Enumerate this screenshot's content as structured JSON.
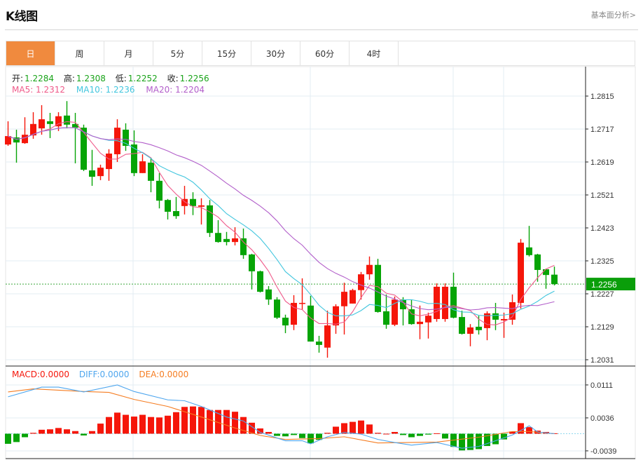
{
  "header": {
    "title": "K线图",
    "link": "基本面分析>"
  },
  "tabs": [
    {
      "label": "日",
      "active": true
    },
    {
      "label": "周"
    },
    {
      "label": "月"
    },
    {
      "label": "5分"
    },
    {
      "label": "15分"
    },
    {
      "label": "30分"
    },
    {
      "label": "60分"
    },
    {
      "label": "4时"
    }
  ],
  "ohlc_info": {
    "open_label": "开:",
    "open": "1.2284",
    "high_label": "高:",
    "high": "1.2308",
    "low_label": "低:",
    "low": "1.2252",
    "close_label": "收:",
    "close": "1.2256"
  },
  "ma_info": {
    "ma5": "MA5: 1.2312",
    "ma10": "MA10: 1.2236",
    "ma20": "MA20: 1.2204"
  },
  "macd_info": {
    "macd": "MACD:0.0000",
    "diff": "DIFF:0.0000",
    "dea": "DEA:0.0000"
  },
  "current_price": "1.2256",
  "colors": {
    "up": "#f5160a",
    "down": "#06a406",
    "ma5": "#ef5a8a",
    "ma10": "#42c6de",
    "ma20": "#b25fca",
    "diff": "#4ea6ee",
    "dea": "#f57d22",
    "accent": "#f08a3e"
  },
  "chart_data": [
    {
      "type": "candlestick",
      "y_ticks": [
        "1.2815",
        "1.2717",
        "1.2619",
        "1.2521",
        "1.2423",
        "1.2325",
        "1.2227",
        "1.2129",
        "1.2031"
      ],
      "ylim": [
        1.2031,
        1.2815
      ],
      "grid": true,
      "candles": [
        [
          1.2671,
          1.274,
          1.2667,
          1.2696
        ],
        [
          1.2692,
          1.2715,
          1.2617,
          1.2677
        ],
        [
          1.2675,
          1.2752,
          1.2673,
          1.27
        ],
        [
          1.2698,
          1.2767,
          1.2688,
          1.2732
        ],
        [
          1.2719,
          1.2788,
          1.27,
          1.2746
        ],
        [
          1.274,
          1.2765,
          1.269,
          1.2732
        ],
        [
          1.2725,
          1.2767,
          1.2711,
          1.2755
        ],
        [
          1.2757,
          1.28,
          1.2719,
          1.273
        ],
        [
          1.2732,
          1.2765,
          1.2615,
          1.2721
        ],
        [
          1.2721,
          1.273,
          1.2592,
          1.2596
        ],
        [
          1.2594,
          1.2655,
          1.2548,
          1.2575
        ],
        [
          1.2577,
          1.2611,
          1.2565,
          1.2602
        ],
        [
          1.2598,
          1.2657,
          1.2563,
          1.2644
        ],
        [
          1.2642,
          1.2746,
          1.2619,
          1.2721
        ],
        [
          1.2715,
          1.2734,
          1.2652,
          1.2667
        ],
        [
          1.2671,
          1.2713,
          1.2577,
          1.2586
        ],
        [
          1.2586,
          1.2642,
          1.2586,
          1.2621
        ],
        [
          1.2617,
          1.2632,
          1.2529,
          1.2563
        ],
        [
          1.2563,
          1.2586,
          1.2481,
          1.2504
        ],
        [
          1.2506,
          1.2509,
          1.2448,
          1.2471
        ],
        [
          1.2473,
          1.2515,
          1.245,
          1.2458
        ],
        [
          1.2488,
          1.2548,
          1.2463,
          1.2509
        ],
        [
          1.2509,
          1.2529,
          1.2461,
          1.2488
        ],
        [
          1.2486,
          1.2511,
          1.2433,
          1.249
        ],
        [
          1.249,
          1.2506,
          1.2396,
          1.2408
        ],
        [
          1.2408,
          1.2446,
          1.2379,
          1.2381
        ],
        [
          1.239,
          1.2411,
          1.2371,
          1.2381
        ],
        [
          1.2381,
          1.2425,
          1.2371,
          1.2392
        ],
        [
          1.2392,
          1.2421,
          1.2331,
          1.2342
        ],
        [
          1.2344,
          1.2346,
          1.224,
          1.2294
        ],
        [
          1.2294,
          1.2296,
          1.2231,
          1.2233
        ],
        [
          1.224,
          1.225,
          1.2194,
          1.221
        ],
        [
          1.221,
          1.2217,
          1.2152,
          1.2156
        ],
        [
          1.2156,
          1.2165,
          1.211,
          1.2133
        ],
        [
          1.2135,
          1.2223,
          1.2119,
          1.22
        ],
        [
          1.2198,
          1.2273,
          1.2179,
          1.22
        ],
        [
          1.2192,
          1.2221,
          1.2085,
          1.2085
        ],
        [
          1.2085,
          1.2102,
          1.2052,
          1.2075
        ],
        [
          1.2067,
          1.2177,
          1.2037,
          1.2133
        ],
        [
          1.2133,
          1.2196,
          1.2108,
          1.219
        ],
        [
          1.219,
          1.226,
          1.2106,
          1.2233
        ],
        [
          1.2198,
          1.2242,
          1.2198,
          1.2238
        ],
        [
          1.2238,
          1.2292,
          1.221,
          1.2285
        ],
        [
          1.2285,
          1.2338,
          1.2269,
          1.2313
        ],
        [
          1.2313,
          1.2331,
          1.2171,
          1.2173
        ],
        [
          1.2175,
          1.2225,
          1.2123,
          1.2135
        ],
        [
          1.2135,
          1.2219,
          1.2131,
          1.221
        ],
        [
          1.221,
          1.2217,
          1.2133,
          1.2181
        ],
        [
          1.2181,
          1.221,
          1.2135,
          1.2137
        ],
        [
          1.2137,
          1.2192,
          1.2092,
          1.2144
        ],
        [
          1.2142,
          1.2171,
          1.2094,
          1.2162
        ],
        [
          1.2152,
          1.2258,
          1.2144,
          1.2248
        ],
        [
          1.2152,
          1.2258,
          1.2144,
          1.2248
        ],
        [
          1.2248,
          1.229,
          1.2154,
          1.2156
        ],
        [
          1.2158,
          1.2177,
          1.2106,
          1.2108
        ],
        [
          1.2108,
          1.2137,
          1.2071,
          1.2127
        ],
        [
          1.2129,
          1.2162,
          1.2106,
          1.2119
        ],
        [
          1.2125,
          1.2175,
          1.2089,
          1.2169
        ],
        [
          1.2169,
          1.22,
          1.2119,
          1.215
        ],
        [
          1.2148,
          1.2171,
          1.2096,
          1.2152
        ],
        [
          1.215,
          1.2225,
          1.2135,
          1.2202
        ],
        [
          1.22,
          1.239,
          1.2183,
          1.2379
        ],
        [
          1.2365,
          1.2429,
          1.2338,
          1.2342
        ],
        [
          1.2344,
          1.2346,
          1.2263,
          1.2298
        ],
        [
          1.23,
          1.2302,
          1.2242,
          1.2283
        ],
        [
          1.2284,
          1.2308,
          1.2252,
          1.2256
        ]
      ],
      "moving_averages": [
        5,
        10,
        20
      ]
    },
    {
      "type": "bar+line",
      "y_ticks": [
        "0.0111",
        "0.0036",
        "-0.0039"
      ],
      "ylim": [
        -0.0039,
        0.0111
      ],
      "macd_hist": [
        -0.0023,
        -0.0019,
        -0.0008,
        0.0002,
        0.0009,
        0.001,
        0.0013,
        0.001,
        0.0006,
        -0.0004,
        0.0006,
        0.0023,
        0.0038,
        0.0048,
        0.0043,
        0.0039,
        0.0043,
        0.0038,
        0.0037,
        0.0041,
        0.0049,
        0.0061,
        0.0062,
        0.0061,
        0.0054,
        0.0054,
        0.0054,
        0.005,
        0.0038,
        0.0025,
        0.0012,
        0.0004,
        -0.0005,
        -0.0006,
        -0.0003,
        -0.001,
        -0.0022,
        -0.0014,
        0.0002,
        0.0016,
        0.0024,
        0.0027,
        0.003,
        0.0021,
        0.0002,
        0.0,
        0.0004,
        -0.0003,
        -0.0008,
        -0.0005,
        -0.0002,
        0.0001,
        -0.0011,
        -0.003,
        -0.0038,
        -0.0037,
        -0.0035,
        -0.0028,
        -0.0024,
        -0.0013,
        0.0005,
        0.0024,
        0.0015,
        0.0007,
        0.0004,
        0.0001
      ],
      "diff_points": [
        [
          0,
          0.0084
        ],
        [
          4,
          0.0106
        ],
        [
          6,
          0.0106
        ],
        [
          9,
          0.0095
        ],
        [
          13,
          0.0111
        ],
        [
          15,
          0.0096
        ],
        [
          19,
          0.0077
        ],
        [
          21,
          0.0075
        ],
        [
          23,
          0.0062
        ],
        [
          26,
          0.0038
        ],
        [
          28,
          0.0029
        ],
        [
          30,
          0.0003
        ],
        [
          33,
          -0.0016
        ],
        [
          35,
          -0.0016
        ],
        [
          36,
          -0.0023
        ],
        [
          38,
          -0.0007
        ],
        [
          40,
          0.0003
        ],
        [
          42,
          -0.0001
        ],
        [
          44,
          -0.0013
        ],
        [
          46,
          -0.002
        ],
        [
          48,
          -0.0026
        ],
        [
          51,
          -0.002
        ],
        [
          54,
          -0.0033
        ],
        [
          56,
          -0.0029
        ],
        [
          60,
          -0.0003
        ],
        [
          62,
          0.0018
        ],
        [
          63,
          0.0004
        ],
        [
          65,
          0.0
        ]
      ],
      "dea_points": [
        [
          0,
          0.0095
        ],
        [
          3,
          0.0102
        ],
        [
          9,
          0.0096
        ],
        [
          12,
          0.0094
        ],
        [
          15,
          0.0078
        ],
        [
          19,
          0.0062
        ],
        [
          23,
          0.0038
        ],
        [
          27,
          0.0013
        ],
        [
          30,
          -0.0004
        ],
        [
          33,
          -0.0013
        ],
        [
          37,
          -0.0011
        ],
        [
          40,
          -0.0007
        ],
        [
          44,
          -0.0021
        ],
        [
          51,
          -0.0019
        ],
        [
          56,
          -0.0008
        ],
        [
          60,
          0.0005
        ],
        [
          62,
          0.0005
        ],
        [
          65,
          0.0
        ]
      ]
    }
  ]
}
